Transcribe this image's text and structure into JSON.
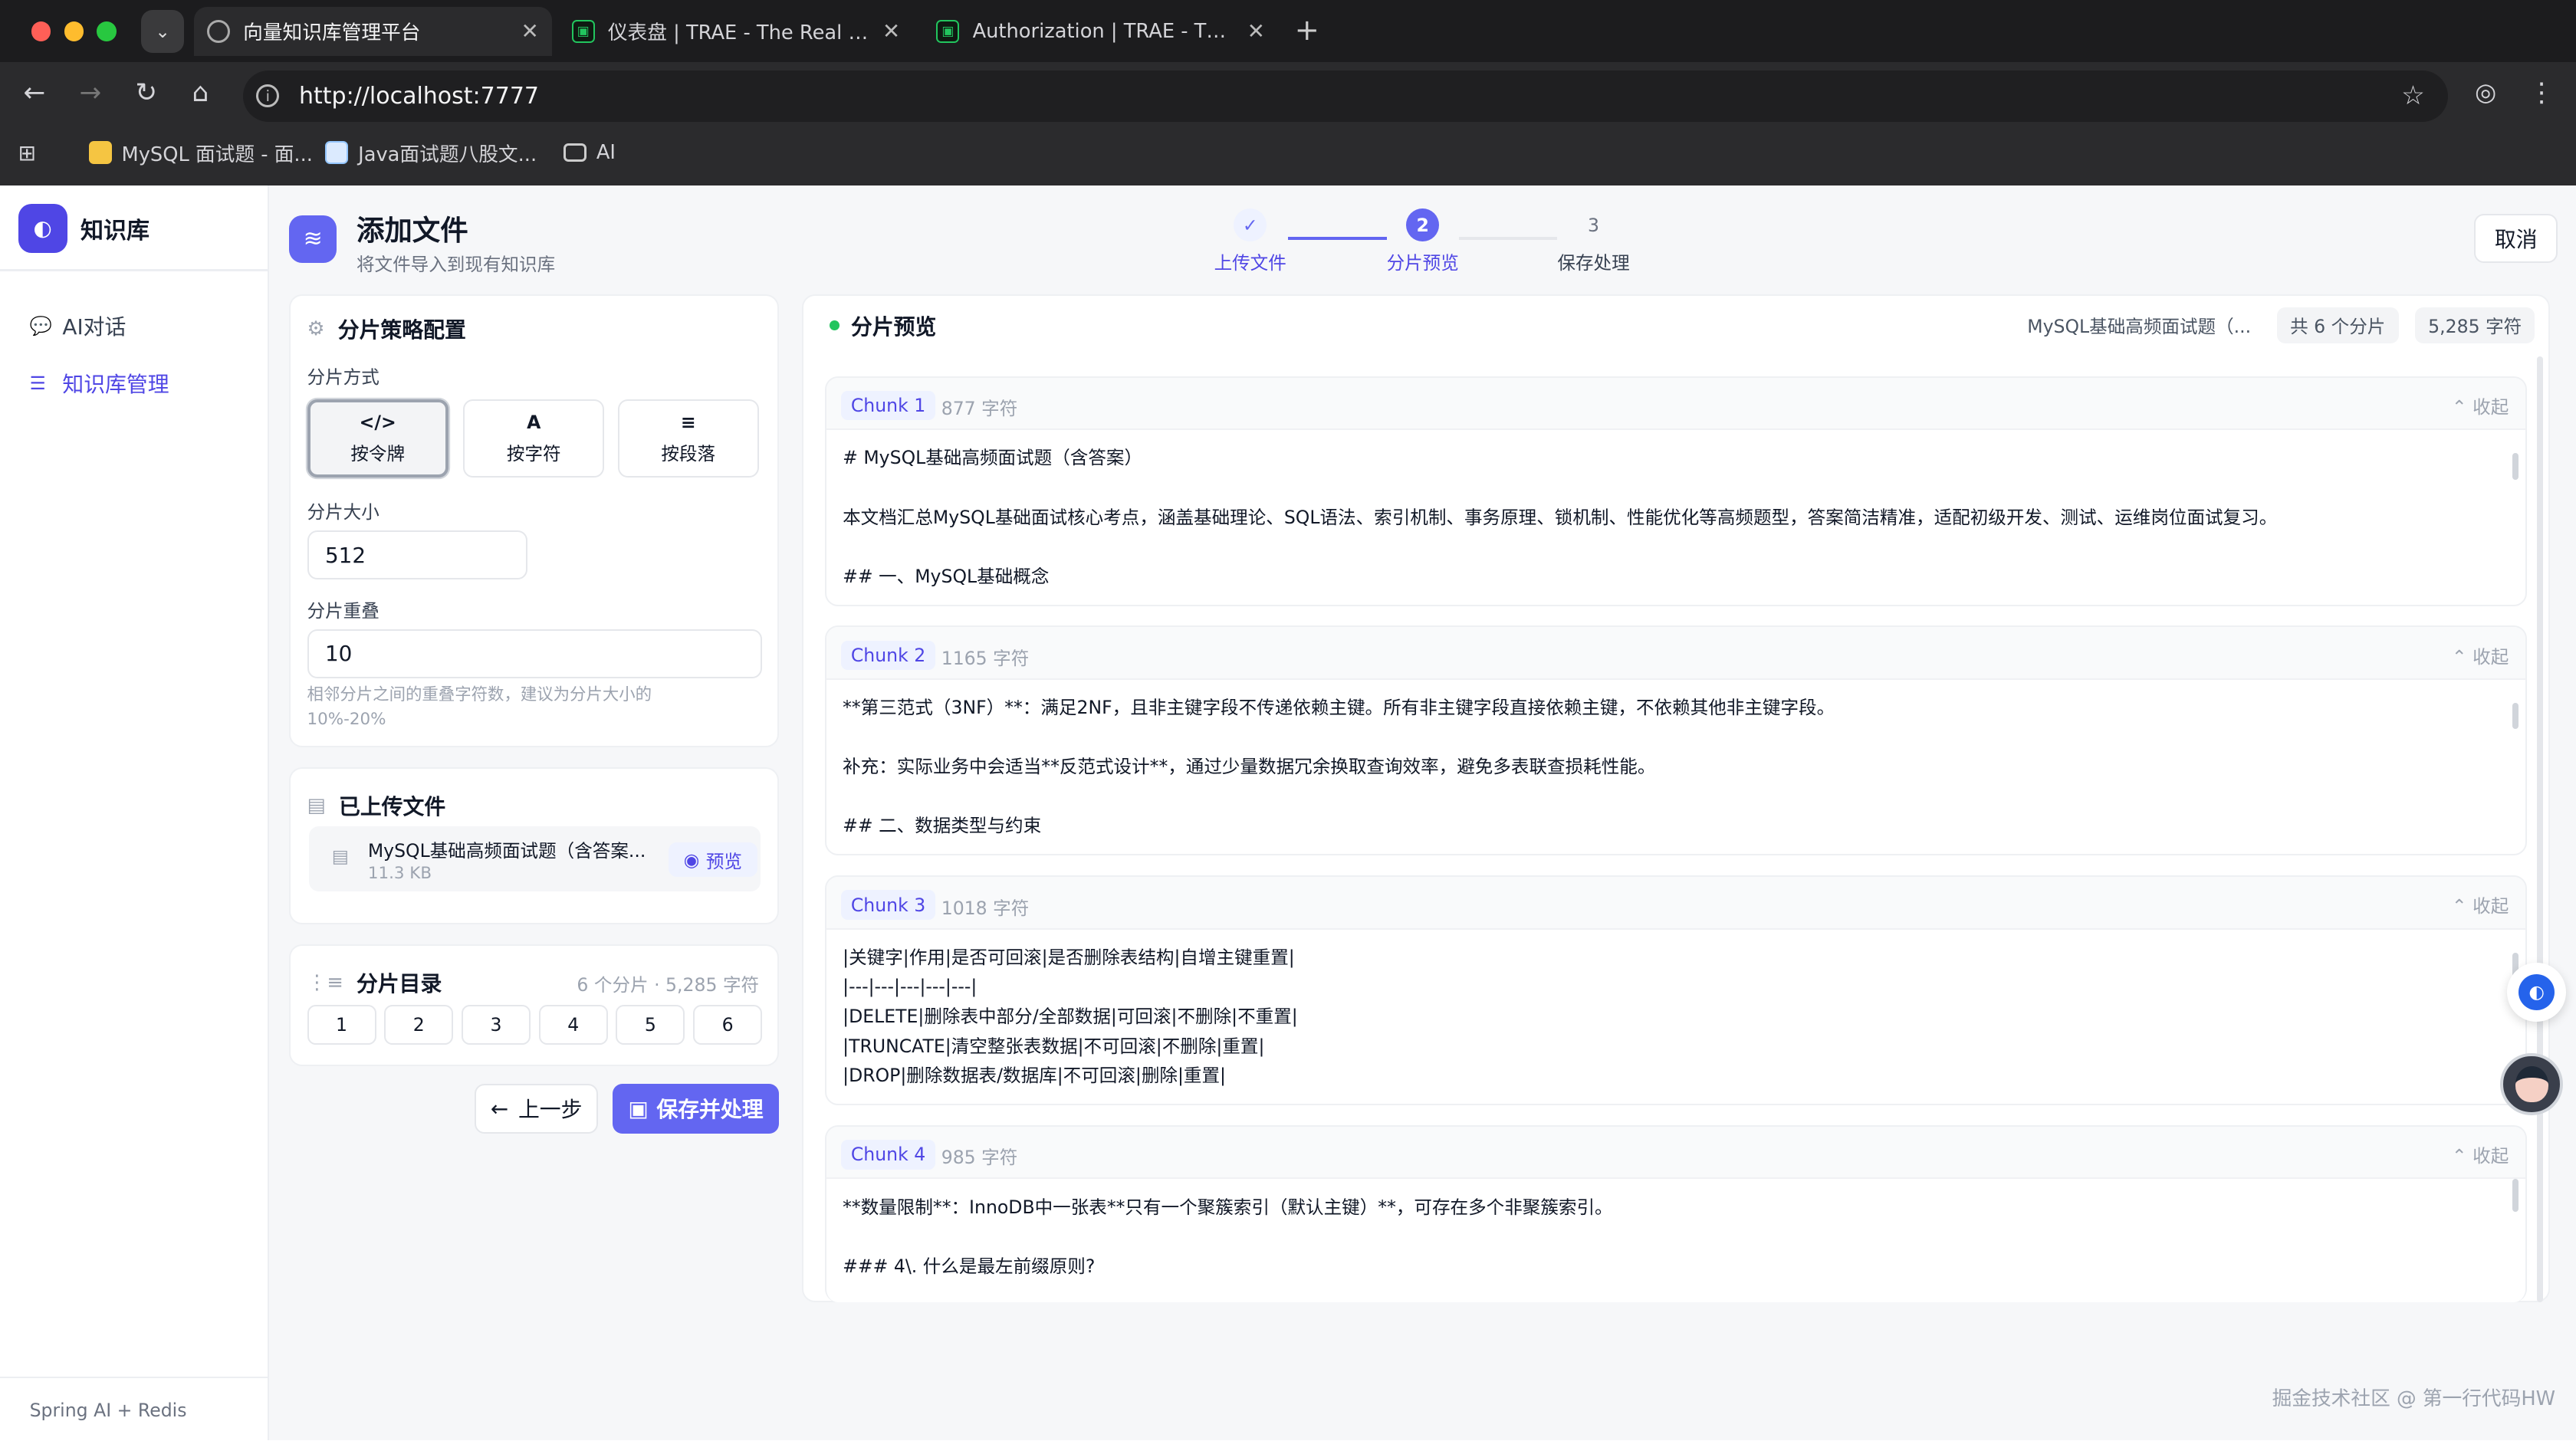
{
  "browser": {
    "tabs": [
      {
        "title": "向量知识库管理平台",
        "active": true,
        "icon": "globe-icon"
      },
      {
        "title": "仪表盘 | TRAE - The Real AI Engineer",
        "active": false,
        "icon": "trae-icon"
      },
      {
        "title": "Authorization | TRAE - The Real AI Engineer",
        "active": false,
        "icon": "trae-icon"
      }
    ],
    "url": "http://localhost:7777",
    "bookmarks": [
      {
        "label": "MySQL 面试题 - 面...",
        "icon": "cat-face-icon"
      },
      {
        "label": "Java面试题八股文...",
        "icon": "site-icon"
      },
      {
        "label": "AI",
        "icon": "folder-icon"
      }
    ]
  },
  "app": {
    "brand": "知识库",
    "nav": [
      {
        "label": "AI对话",
        "icon": "chat-icon",
        "active": false
      },
      {
        "label": "知识库管理",
        "icon": "list-icon",
        "active": true
      }
    ],
    "footer": "Spring AI + Redis"
  },
  "header": {
    "title": "添加文件",
    "subtitle": "将文件导入到现有知识库",
    "cancel_label": "取消"
  },
  "steps": [
    {
      "number": "✓",
      "label": "上传文件",
      "state": "done"
    },
    {
      "number": "2",
      "label": "分片预览",
      "state": "current"
    },
    {
      "number": "3",
      "label": "保存处理",
      "state": "pending"
    }
  ],
  "strategy": {
    "title": "分片策略配置",
    "mode_label": "分片方式",
    "modes": [
      {
        "icon": "</>",
        "label": "按令牌",
        "selected": true
      },
      {
        "icon": "A",
        "label": "按字符",
        "selected": false
      },
      {
        "icon": "≡",
        "label": "按段落",
        "selected": false
      }
    ],
    "size_label": "分片大小",
    "size_value": "512",
    "overlap_label": "分片重叠",
    "overlap_value": "10",
    "overlap_hint_line1": "相邻分片之间的重叠字符数，建议为分片大小的",
    "overlap_hint_line2": "10%-20%"
  },
  "uploaded": {
    "title": "已上传文件",
    "file_name": "MySQL基础高频面试题（含答案...",
    "file_size": "11.3 KB",
    "preview_label": "预览"
  },
  "catalog": {
    "title": "分片目录",
    "summary": "6 个分片 · 5,285 字符",
    "pages": [
      "1",
      "2",
      "3",
      "4",
      "5",
      "6"
    ]
  },
  "actions": {
    "prev_label": "上一步",
    "save_label": "保存并处理"
  },
  "preview": {
    "title": "分片预览",
    "file_pill": "MySQL基础高频面试题（...",
    "count_pill": "共 6 个分片",
    "chars_pill": "5,285 字符",
    "collapse_label": "收起",
    "chunks": [
      {
        "tag": "Chunk 1",
        "length": "877 字符",
        "lines": [
          "# MySQL基础高频面试题（含答案）",
          "",
          "本文档汇总MySQL基础面试核心考点，涵盖基础理论、SQL语法、索引机制、事务原理、锁机制、性能优化等高频题型，答案简洁精准，适配初级开发、测试、运维岗位面试复习。",
          "",
          "## 一、MySQL基础概念"
        ]
      },
      {
        "tag": "Chunk 2",
        "length": "1165 字符",
        "lines": [
          "**第三范式（3NF）**：满足2NF，且非主键字段不传递依赖主键。所有非主键字段直接依赖主键，不依赖其他非主键字段。",
          "",
          "补充：实际业务中会适当**反范式设计**，通过少量数据冗余换取查询效率，避免多表联查损耗性能。",
          "",
          "## 二、数据类型与约束"
        ]
      },
      {
        "tag": "Chunk 3",
        "length": "1018 字符",
        "lines": [
          "|关键字|作用|是否可回滚|是否删除表结构|自增主键重置|",
          "|---|---|---|---|---|",
          "|DELETE|删除表中部分/全部数据|可回滚|不删除|不重置|",
          "|TRUNCATE|清空整张表数据|不可回滚|不删除|重置|",
          "|DROP|删除数据表/数据库|不可回滚|删除|重置|"
        ]
      },
      {
        "tag": "Chunk 4",
        "length": "985 字符",
        "lines": [
          "**数量限制**：InnoDB中一张表**只有一个聚簇索引（默认主键）**，可存在多个非聚簇索引。",
          "",
          "### 4\\. 什么是最左前缀原则?"
        ]
      }
    ]
  },
  "watermark": "掘金技术社区 @ 第一行代码HW",
  "colors": {
    "accent": "#6366f1",
    "brand": "#4f46e5",
    "status_dot": "#22c55e"
  }
}
